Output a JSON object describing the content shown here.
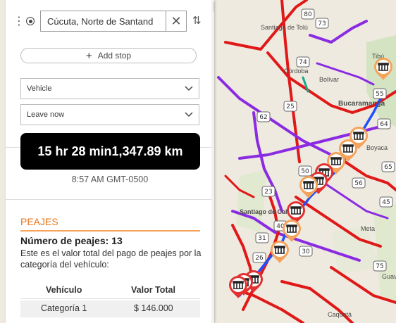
{
  "map": {
    "road_labels": [
      "80",
      "73",
      "74",
      "62",
      "25",
      "55",
      "64",
      "65",
      "50",
      "56",
      "45",
      "23",
      "40",
      "31",
      "26",
      "30",
      "75"
    ],
    "place_labels": [
      "Santiago de Tolú",
      "Córdoba",
      "Bolívar",
      "Tibú",
      "Bucaramanga",
      "Boyaca",
      "Santiago de Cali",
      "Meta",
      "Guav",
      "Caquetá"
    ],
    "colors": {
      "background": "#efeae0",
      "toll_marker": "#f5a25a",
      "toll_marker_red": "#e33030",
      "road_red": "#e01818",
      "road_purple": "#8a2be2",
      "road_blue": "#1f4fff"
    }
  },
  "directions": {
    "drag_icon": "drag-handle-icon",
    "origin_icon": "origin-radio-icon",
    "origin_value": "Cúcuta, Norte de Santand",
    "clear_icon": "close-icon",
    "swap_icon": "swap-icon",
    "add_stop_label": "Add stop",
    "add_stop_icon": "plus-icon",
    "vehicle_select": "Vehicle",
    "time_select": "Leave now",
    "summary": {
      "duration": "15 hr 28 min",
      "distance": "1,347.89 km"
    },
    "arrival_time": "8:57 AM GMT-0500"
  },
  "peajes": {
    "title": "PEAJES",
    "count_label": "Número de peajes:",
    "count_value": "13",
    "description": "Este es el valor total del pago de peajes por la categoría del vehículo:",
    "headers": [
      "Vehículo",
      "Valor Total"
    ],
    "rows": [
      {
        "vehicle": "Categoría 1",
        "total": "$ 146.000"
      }
    ]
  }
}
